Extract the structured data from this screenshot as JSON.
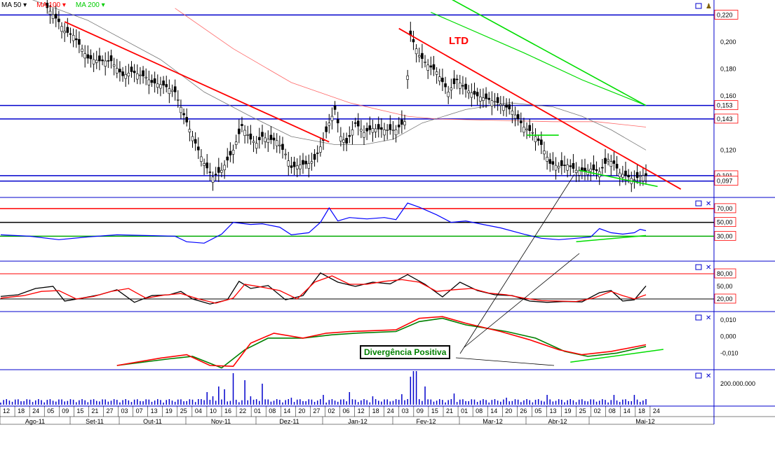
{
  "legend": {
    "ma50": "MA 50",
    "ma100": "MA 100",
    "ma200": "MA 200",
    "ma50_color": "#000000",
    "ma100_color": "#ff0000",
    "ma200_color": "#00cc00"
  },
  "annotations": {
    "ltd": "LTD",
    "divergence": "Divergência Positiva"
  },
  "colors": {
    "panel_border": "#0000cc",
    "h_line": "#0000cc",
    "trend_red": "#ff0000",
    "trend_green": "#00dd00",
    "rsi_line": "#0000ff",
    "stoch_k": "#000000",
    "stoch_d": "#ff0000",
    "macd": "#ff0000",
    "signal": "#008000",
    "volume": "#0000cc"
  },
  "chart_data": [
    {
      "type": "candlestick",
      "name": "price",
      "y_ticks": [
        "0,200",
        "0,180",
        "0,160",
        "0,120"
      ],
      "ylim": [
        0.088,
        0.228
      ],
      "price_labels": [
        {
          "value": 0.22,
          "text": "0,220"
        },
        {
          "value": 0.153,
          "text": "0,153"
        },
        {
          "value": 0.143,
          "text": "0,143"
        },
        {
          "value": 0.101,
          "text": "0,101"
        },
        {
          "value": 0.097,
          "text": "0,097"
        }
      ],
      "horizontal_levels": [
        0.22,
        0.153,
        0.143,
        0.101,
        0.097
      ],
      "close_path": [
        [
          0,
          0.236
        ],
        [
          15,
          0.228
        ],
        [
          20,
          0.215
        ],
        [
          22,
          0.208
        ],
        [
          25,
          0.205
        ],
        [
          30,
          0.188
        ],
        [
          34,
          0.186
        ],
        [
          38,
          0.186
        ],
        [
          42,
          0.175
        ],
        [
          45,
          0.178
        ],
        [
          50,
          0.174
        ],
        [
          52,
          0.17
        ],
        [
          56,
          0.168
        ],
        [
          60,
          0.163
        ],
        [
          63,
          0.146
        ],
        [
          66,
          0.13
        ],
        [
          70,
          0.11
        ],
        [
          73,
          0.1
        ],
        [
          76,
          0.105
        ],
        [
          80,
          0.12
        ],
        [
          83,
          0.138
        ],
        [
          86,
          0.128
        ],
        [
          88,
          0.125
        ],
        [
          90,
          0.13
        ],
        [
          92,
          0.128
        ],
        [
          95,
          0.127
        ],
        [
          98,
          0.117
        ],
        [
          100,
          0.107
        ],
        [
          103,
          0.109
        ],
        [
          106,
          0.11
        ],
        [
          108,
          0.113
        ],
        [
          111,
          0.127
        ],
        [
          113,
          0.14
        ],
        [
          115,
          0.15
        ],
        [
          117,
          0.13
        ],
        [
          119,
          0.125
        ],
        [
          122,
          0.14
        ],
        [
          125,
          0.133
        ],
        [
          128,
          0.136
        ],
        [
          132,
          0.135
        ],
        [
          136,
          0.135
        ],
        [
          139,
          0.141
        ],
        [
          140,
          0.175
        ],
        [
          141,
          0.205
        ],
        [
          144,
          0.19
        ],
        [
          147,
          0.183
        ],
        [
          150,
          0.178
        ],
        [
          154,
          0.163
        ],
        [
          157,
          0.172
        ],
        [
          160,
          0.165
        ],
        [
          164,
          0.16
        ],
        [
          167,
          0.158
        ],
        [
          170,
          0.156
        ],
        [
          173,
          0.153
        ],
        [
          176,
          0.149
        ],
        [
          180,
          0.137
        ],
        [
          183,
          0.133
        ],
        [
          186,
          0.124
        ],
        [
          189,
          0.11
        ],
        [
          192,
          0.108
        ],
        [
          195,
          0.109
        ],
        [
          198,
          0.105
        ],
        [
          201,
          0.104
        ],
        [
          203,
          0.106
        ],
        [
          206,
          0.104
        ],
        [
          209,
          0.113
        ],
        [
          211,
          0.11
        ],
        [
          213,
          0.103
        ],
        [
          216,
          0.1
        ],
        [
          218,
          0.098
        ],
        [
          220,
          0.101
        ],
        [
          222,
          0.101
        ]
      ],
      "ma50_path": [
        [
          0,
          0.24
        ],
        [
          30,
          0.216
        ],
        [
          55,
          0.187
        ],
        [
          70,
          0.163
        ],
        [
          85,
          0.146
        ],
        [
          100,
          0.13
        ],
        [
          115,
          0.124
        ],
        [
          125,
          0.124
        ],
        [
          135,
          0.128
        ],
        [
          145,
          0.14
        ],
        [
          160,
          0.15
        ],
        [
          175,
          0.155
        ],
        [
          190,
          0.152
        ],
        [
          200,
          0.145
        ],
        [
          210,
          0.135
        ],
        [
          222,
          0.12
        ]
      ],
      "ma100_path": [
        [
          60,
          0.225
        ],
        [
          80,
          0.195
        ],
        [
          100,
          0.17
        ],
        [
          120,
          0.155
        ],
        [
          140,
          0.145
        ],
        [
          150,
          0.143
        ],
        [
          170,
          0.142
        ],
        [
          190,
          0.141
        ],
        [
          205,
          0.141
        ],
        [
          222,
          0.137
        ]
      ],
      "ma200_path": [
        [
          148,
          0.222
        ],
        [
          180,
          0.192
        ],
        [
          200,
          0.172
        ],
        [
          222,
          0.153
        ]
      ],
      "trendlines_red": [
        {
          "from": [
            22,
            0.215
          ],
          "to": [
            113,
            0.126
          ]
        },
        {
          "from": [
            137,
            0.21
          ],
          "to": [
            234,
            0.091
          ]
        }
      ],
      "trendlines_green": [
        {
          "from": [
            148,
            0.24
          ],
          "to": [
            222,
            0.153
          ]
        },
        {
          "from": [
            199,
            0.105
          ],
          "to": [
            226,
            0.093
          ]
        },
        {
          "from": [
            181,
            0.131
          ],
          "to": [
            192,
            0.131
          ]
        }
      ]
    },
    {
      "type": "line",
      "name": "RSI",
      "y_ticks": [
        "70,00",
        "50,00",
        "30,00"
      ],
      "levels": [
        70,
        50,
        30
      ],
      "ylim": [
        0,
        80
      ],
      "path": [
        [
          0,
          32
        ],
        [
          10,
          30
        ],
        [
          20,
          25
        ],
        [
          30,
          29
        ],
        [
          40,
          32
        ],
        [
          50,
          31
        ],
        [
          60,
          30
        ],
        [
          64,
          22
        ],
        [
          70,
          20
        ],
        [
          76,
          33
        ],
        [
          80,
          50
        ],
        [
          86,
          47
        ],
        [
          90,
          48
        ],
        [
          96,
          43
        ],
        [
          100,
          32
        ],
        [
          106,
          35
        ],
        [
          110,
          50
        ],
        [
          113,
          71
        ],
        [
          116,
          52
        ],
        [
          120,
          57
        ],
        [
          126,
          55
        ],
        [
          132,
          57
        ],
        [
          136,
          54
        ],
        [
          140,
          78
        ],
        [
          144,
          72
        ],
        [
          150,
          61
        ],
        [
          155,
          50
        ],
        [
          160,
          52
        ],
        [
          166,
          47
        ],
        [
          172,
          42
        ],
        [
          180,
          33
        ],
        [
          186,
          27
        ],
        [
          192,
          25
        ],
        [
          198,
          27
        ],
        [
          203,
          29
        ],
        [
          206,
          41
        ],
        [
          210,
          35
        ],
        [
          214,
          33
        ],
        [
          218,
          35
        ],
        [
          220,
          40
        ],
        [
          222,
          38
        ]
      ],
      "trendline": {
        "from": [
          198,
          22
        ],
        "to": [
          222,
          31
        ]
      }
    },
    {
      "type": "line",
      "name": "Stochastic",
      "y_ticks": [
        "80,00",
        "50,00",
        "20,00"
      ],
      "levels": [
        80,
        20
      ],
      "ylim": [
        0,
        100
      ],
      "k_path": [
        [
          0,
          26
        ],
        [
          6,
          30
        ],
        [
          12,
          45
        ],
        [
          18,
          50
        ],
        [
          22,
          15
        ],
        [
          28,
          22
        ],
        [
          34,
          30
        ],
        [
          40,
          42
        ],
        [
          46,
          12
        ],
        [
          52,
          28
        ],
        [
          58,
          30
        ],
        [
          62,
          38
        ],
        [
          66,
          20
        ],
        [
          72,
          8
        ],
        [
          78,
          18
        ],
        [
          82,
          62
        ],
        [
          86,
          45
        ],
        [
          92,
          52
        ],
        [
          98,
          18
        ],
        [
          104,
          28
        ],
        [
          110,
          82
        ],
        [
          116,
          60
        ],
        [
          122,
          50
        ],
        [
          128,
          60
        ],
        [
          134,
          56
        ],
        [
          140,
          78
        ],
        [
          146,
          55
        ],
        [
          152,
          25
        ],
        [
          158,
          60
        ],
        [
          164,
          40
        ],
        [
          170,
          30
        ],
        [
          176,
          28
        ],
        [
          182,
          15
        ],
        [
          188,
          12
        ],
        [
          194,
          14
        ],
        [
          200,
          13
        ],
        [
          206,
          35
        ],
        [
          210,
          40
        ],
        [
          214,
          15
        ],
        [
          218,
          18
        ],
        [
          222,
          51
        ]
      ],
      "d_path": [
        [
          0,
          22
        ],
        [
          8,
          28
        ],
        [
          14,
          38
        ],
        [
          20,
          40
        ],
        [
          26,
          20
        ],
        [
          32,
          26
        ],
        [
          38,
          38
        ],
        [
          44,
          45
        ],
        [
          50,
          22
        ],
        [
          56,
          29
        ],
        [
          62,
          33
        ],
        [
          68,
          20
        ],
        [
          74,
          10
        ],
        [
          80,
          22
        ],
        [
          84,
          55
        ],
        [
          90,
          48
        ],
        [
          96,
          40
        ],
        [
          102,
          20
        ],
        [
          108,
          60
        ],
        [
          114,
          75
        ],
        [
          120,
          55
        ],
        [
          126,
          55
        ],
        [
          132,
          62
        ],
        [
          138,
          66
        ],
        [
          144,
          60
        ],
        [
          150,
          38
        ],
        [
          156,
          42
        ],
        [
          162,
          45
        ],
        [
          168,
          34
        ],
        [
          174,
          30
        ],
        [
          180,
          22
        ],
        [
          186,
          16
        ],
        [
          192,
          15
        ],
        [
          198,
          14
        ],
        [
          204,
          22
        ],
        [
          210,
          38
        ],
        [
          214,
          28
        ],
        [
          218,
          20
        ],
        [
          222,
          30
        ]
      ]
    },
    {
      "type": "line",
      "name": "MACD",
      "y_ticks": [
        "0,010",
        "0,000",
        "-0,010"
      ],
      "ylim": [
        -0.0175,
        0.0125
      ],
      "macd_path": [
        [
          40,
          -0.0175
        ],
        [
          55,
          -0.013
        ],
        [
          64,
          -0.011
        ],
        [
          72,
          -0.0175
        ],
        [
          80,
          -0.018
        ],
        [
          86,
          -0.004
        ],
        [
          94,
          0.002
        ],
        [
          104,
          -0.001
        ],
        [
          112,
          0.002
        ],
        [
          120,
          0.003
        ],
        [
          136,
          0.004
        ],
        [
          144,
          0.011
        ],
        [
          152,
          0.012
        ],
        [
          160,
          0.008
        ],
        [
          172,
          0.003
        ],
        [
          182,
          -0.002
        ],
        [
          192,
          -0.008
        ],
        [
          200,
          -0.011
        ],
        [
          210,
          -0.009
        ],
        [
          222,
          -0.005
        ]
      ],
      "signal_path": [
        [
          40,
          -0.0175
        ],
        [
          58,
          -0.0135
        ],
        [
          66,
          -0.012
        ],
        [
          76,
          -0.019
        ],
        [
          84,
          -0.008
        ],
        [
          92,
          -0.001
        ],
        [
          104,
          -0.001
        ],
        [
          114,
          0.001
        ],
        [
          122,
          0.002
        ],
        [
          136,
          0.003
        ],
        [
          144,
          0.009
        ],
        [
          152,
          0.011
        ],
        [
          160,
          0.007
        ],
        [
          174,
          0.003
        ],
        [
          184,
          -0.001
        ],
        [
          194,
          -0.009
        ],
        [
          202,
          -0.012
        ],
        [
          212,
          -0.01
        ],
        [
          222,
          -0.006
        ]
      ],
      "trendline": {
        "from": [
          196,
          -0.0155
        ],
        "to": [
          228,
          -0.0078
        ]
      }
    },
    {
      "type": "bar",
      "name": "Volume",
      "y_ticks": [
        "200.000.000"
      ],
      "ylim": [
        0,
        430000000
      ],
      "spikes": [
        [
          68,
          8
        ],
        [
          71,
          18
        ],
        [
          73,
          12
        ],
        [
          75,
          26
        ],
        [
          77,
          22
        ],
        [
          80,
          45
        ],
        [
          84,
          35
        ],
        [
          86,
          12
        ],
        [
          90,
          30
        ],
        [
          100,
          10
        ],
        [
          111,
          14
        ],
        [
          120,
          18
        ],
        [
          128,
          12
        ],
        [
          138,
          15
        ],
        [
          141,
          40
        ],
        [
          142,
          48
        ],
        [
          143,
          48
        ],
        [
          146,
          26
        ],
        [
          156,
          16
        ],
        [
          174,
          10
        ],
        [
          188,
          14
        ],
        [
          211,
          14
        ],
        [
          218,
          14
        ]
      ]
    }
  ],
  "x_axis": {
    "day_labels": [
      "12",
      "18",
      "24",
      "05",
      "09",
      "15",
      "21",
      "27",
      "03",
      "07",
      "13",
      "19",
      "25",
      "04",
      "10",
      "16",
      "22",
      "01",
      "08",
      "14",
      "20",
      "27",
      "02",
      "06",
      "12",
      "18",
      "24",
      "03",
      "09",
      "15",
      "21",
      "01",
      "08",
      "14",
      "20",
      "26",
      "05",
      "13",
      "19",
      "25",
      "02",
      "08",
      "14",
      "18",
      "24"
    ],
    "month_labels": [
      "Ago-11",
      "Set-11",
      "Out-11",
      "Nov-11",
      "Dez-11",
      "Jan-12",
      "Fev-12",
      "Mar-12",
      "Abr-12",
      "Mai-12"
    ]
  }
}
